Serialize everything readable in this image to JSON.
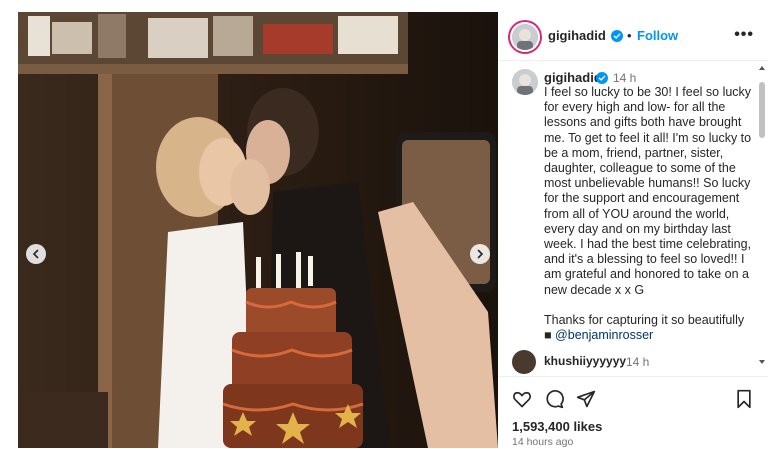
{
  "post": {
    "username": "gigihadid",
    "separator": "•",
    "follow_label": "Follow",
    "more_label": "•••",
    "caption_time": "14 h",
    "caption_text": "I feel so lucky to be 30! I feel so lucky for every high and low- for all the lessons and gifts both have brought me. To get to feel it all! I'm so lucky to be a mom, friend, partner, sister, daughter, colleague to some of the most unbelievable humans!! So lucky for the support and encouragement from all of YOU around the world, every day and on my birthday last week. I had the best time celebrating, and it's a blessing to feel so loved!! I am grateful and honored to take on a new decade x x G",
    "caption_credit_prefix": "Thanks for capturing it so beautifully",
    "credit_handle": "@benjaminrosser",
    "likes": "1,593,400 likes",
    "posted_ago": "14 hours ago"
  },
  "comment": {
    "username": "khushiiyyyyyy",
    "time": "14 h"
  },
  "colors": {
    "accent": "#0095f6",
    "link": "#00376b",
    "story_ring": "#d62976"
  },
  "icons": [
    "verified-badge-icon",
    "chevron-left-icon",
    "chevron-right-icon",
    "heart-icon",
    "comment-icon",
    "share-icon",
    "bookmark-icon",
    "camera-icon"
  ]
}
